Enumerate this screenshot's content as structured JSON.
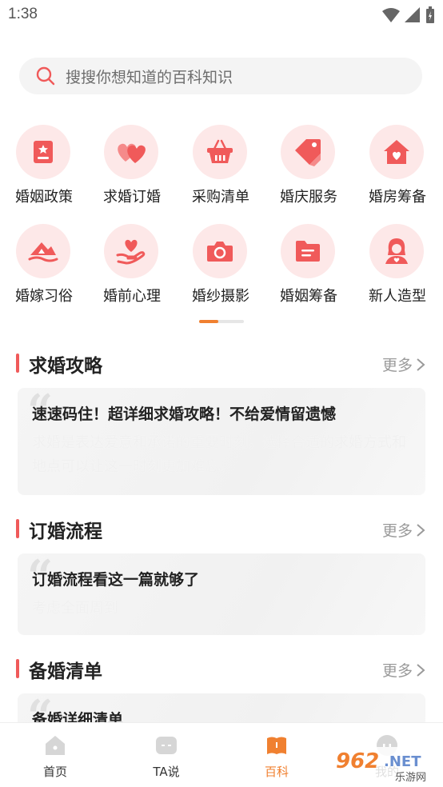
{
  "status_bar": {
    "time": "1:38"
  },
  "search": {
    "placeholder": "搜搜你想知道的百科知识"
  },
  "categories": [
    {
      "label": "婚姻政策",
      "icon": "policy-document-icon"
    },
    {
      "label": "求婚订婚",
      "icon": "hearts-icon"
    },
    {
      "label": "采购清单",
      "icon": "shopping-basket-icon"
    },
    {
      "label": "婚庆服务",
      "icon": "tag-icon"
    },
    {
      "label": "婚房筹备",
      "icon": "house-heart-icon"
    },
    {
      "label": "婚嫁习俗",
      "icon": "mountain-icon"
    },
    {
      "label": "婚前心理",
      "icon": "hand-heart-icon"
    },
    {
      "label": "婚纱摄影",
      "icon": "camera-icon"
    },
    {
      "label": "婚姻筹备",
      "icon": "folder-icon"
    },
    {
      "label": "新人造型",
      "icon": "person-icon"
    }
  ],
  "sections": [
    {
      "title": "求婚攻略",
      "more": "更多",
      "card_title": "速速码住！超详细求婚攻略！不给爱情留遗憾",
      "card_desc": "求婚是表达爱意和承诺的重要时刻，选择合适的求婚方式和地点可以让这一时刻更加难忘。"
    },
    {
      "title": "订婚流程",
      "more": "更多",
      "card_title": "订婚流程看这一篇就够了",
      "card_desc": "考虑全面周到"
    },
    {
      "title": "备婚清单",
      "more": "更多",
      "card_title": "备婚详细清单",
      "card_desc": ""
    }
  ],
  "bottom_nav": [
    {
      "label": "首页",
      "icon": "home-icon"
    },
    {
      "label": "TA说",
      "icon": "chat-icon"
    },
    {
      "label": "百科",
      "icon": "book-icon",
      "active": true
    },
    {
      "label": "我的",
      "icon": "profile-icon"
    }
  ],
  "watermark": {
    "text": "962.NET",
    "subtext": "乐游网"
  },
  "colors": {
    "accent": "#f08030",
    "icon_red": "#f05a5a",
    "icon_bg": "#fde8e8"
  }
}
